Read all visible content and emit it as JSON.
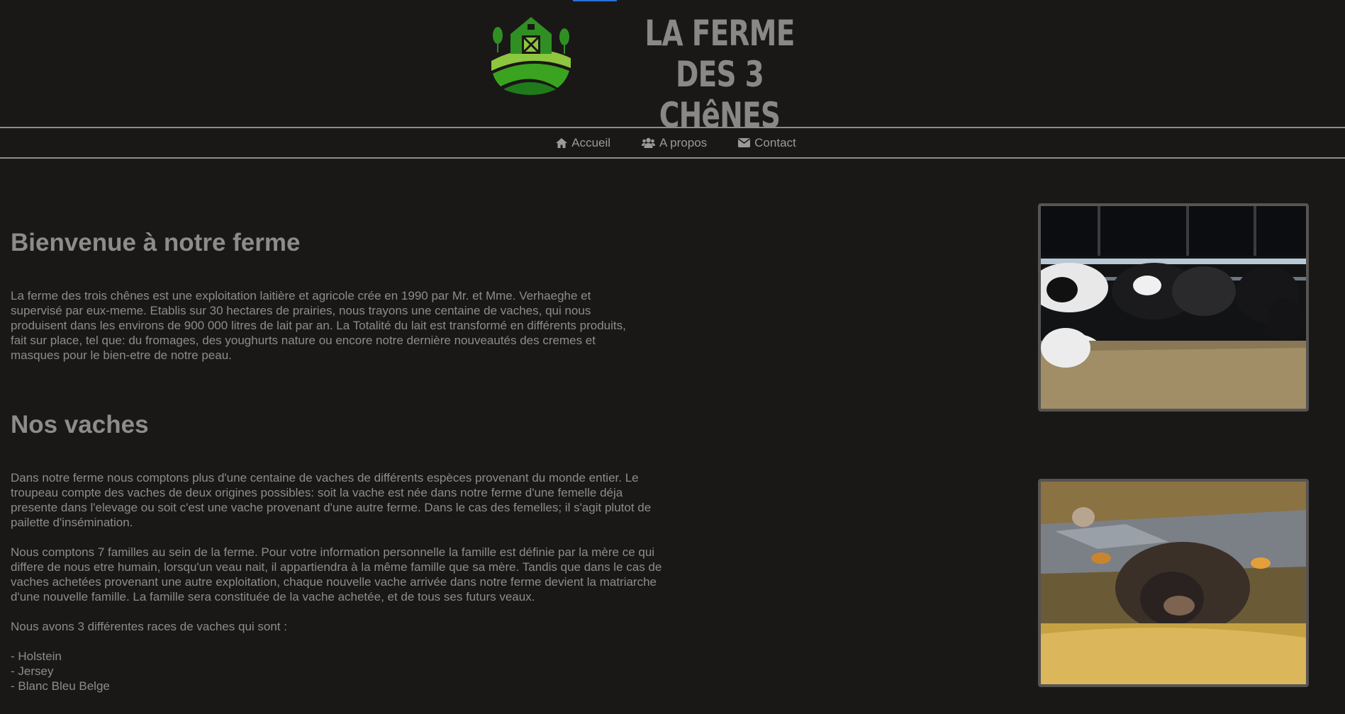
{
  "site": {
    "title_line1": "LA FERME DES 3",
    "title_line2": "CHêNES"
  },
  "nav": {
    "items": [
      {
        "label": "Accueil",
        "icon": "home-icon"
      },
      {
        "label": "A propos",
        "icon": "users-icon"
      },
      {
        "label": "Contact",
        "icon": "envelope-icon"
      }
    ]
  },
  "welcome": {
    "heading": "Bienvenue à notre ferme",
    "text": "La ferme des trois chênes est une exploitation laitière et agricole crée en 1990 par Mr. et Mme. Verhaeghe et supervisé par eux-meme. Etablis sur 30 hectares de prairies, nous trayons une centaine de vaches, qui nous produisent dans les environs de 900 000 litres de lait par an. La Totalité du lait est transformé en différents produits, fait sur place, tel que: du fromages, des youghurts nature ou encore notre dernière nouveautés des cremes et masques pour le bien-etre de notre peau."
  },
  "cows": {
    "heading": "Nos vaches",
    "p1": "Dans notre ferme nous comptons plus d'une centaine de vaches de différents espèces provenant du monde entier. Le troupeau compte des vaches de deux origines possibles: soit la vache est née dans notre ferme d'une femelle déja presente dans l'elevage ou soit c'est une vache provenant d'une autre ferme. Dans le cas des femelles; il s'agit plutot de pailette d'insémination.",
    "p2": "Nous comptons 7 familles au sein de la ferme. Pour votre information personnelle la famille est définie par la mère ce qui differe de nous etre humain, lorsqu'un veau nait, il appartiendra à la même famille que sa mère. Tandis que dans le cas de vaches achetées provenant une autre exploitation, chaque nouvelle vache arrivée dans notre ferme devient la matriarche d'une nouvelle famille. La famille sera constituée de la vache achetée, et de tous ses futurs veaux.",
    "p3": "Nous avons 3 différentes races de vaches qui sont :",
    "breeds": [
      "- Holstein",
      "- Jersey",
      "- Blanc Bleu Belge"
    ]
  },
  "colors": {
    "background": "#1a1717",
    "text": "#8e8b8b",
    "logo_green": "#3aa31f"
  }
}
